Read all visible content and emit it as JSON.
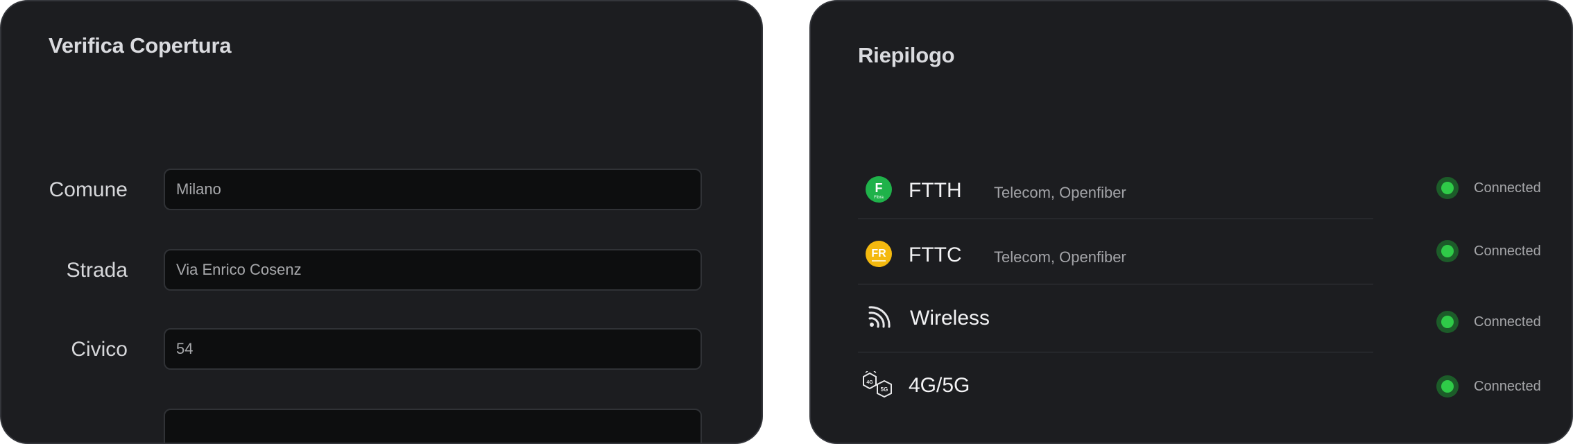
{
  "coverage": {
    "title": "Verifica Copertura",
    "fields": [
      {
        "label": "Comune",
        "value": "Milano"
      },
      {
        "label": "Strada",
        "value": "Via Enrico Cosenz"
      },
      {
        "label": "Civico",
        "value": "54"
      },
      {
        "label": "",
        "value": ""
      }
    ]
  },
  "summary": {
    "title": "Riepilogo",
    "items": [
      {
        "icon": "fibra-icon",
        "icon_letter": "F",
        "icon_sub": "Fibra",
        "name": "FTTH",
        "providers": "Telecom, Openfiber",
        "status": "Connected"
      },
      {
        "icon": "fibra-ridotta-icon",
        "icon_letter": "FR",
        "icon_sub": "",
        "name": "FTTC",
        "providers": "Telecom, Openfiber",
        "status": "Connected"
      },
      {
        "icon": "wireless-icon",
        "name": "Wireless",
        "providers": "",
        "status": "Connected"
      },
      {
        "icon": "4g-5g-icon",
        "icon_4g": "4G",
        "icon_5g": "5G",
        "name": "4G/5G",
        "providers": "",
        "status": "Connected"
      }
    ]
  },
  "colors": {
    "panel_bg": "#1c1d20",
    "status_green": "#2fcb48",
    "ftth_icon": "#1fb24a",
    "fttc_icon": "#f4b90f"
  }
}
